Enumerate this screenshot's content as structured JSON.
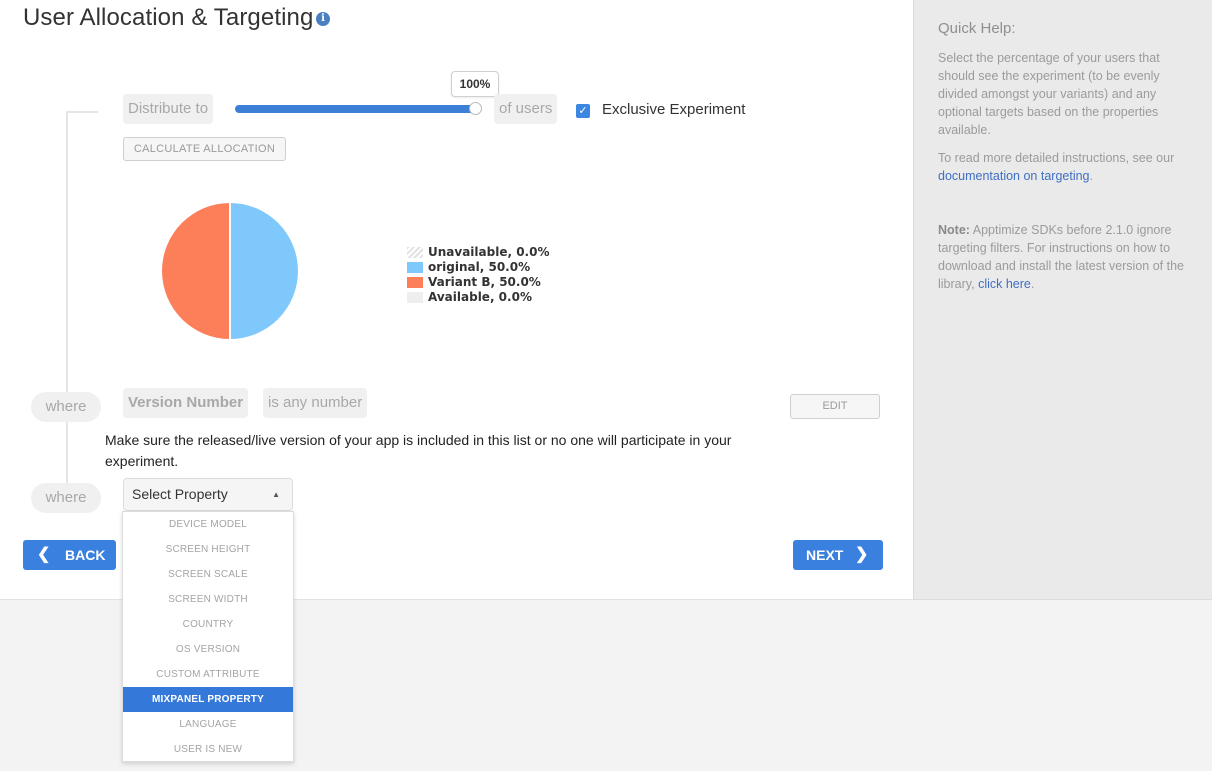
{
  "header": {
    "title": "User Allocation & Targeting"
  },
  "allocation": {
    "distribute_label": "Distribute to",
    "slider_value": "100%",
    "slider_fraction": 1.0,
    "of_users_label": "of users",
    "exclusive_checked": true,
    "exclusive_label": "Exclusive Experiment",
    "calculate_label": "CALCULATE ALLOCATION"
  },
  "pie": {
    "legend": [
      {
        "label": "Unavailable, 0.0%",
        "value": 0.0,
        "color": "hatched"
      },
      {
        "label": "original, 50.0%",
        "value": 50.0,
        "color": "#7ec8fb"
      },
      {
        "label": "Variant B, 50.0%",
        "value": 50.0,
        "color": "#fc7f5a"
      },
      {
        "label": "Available, 0.0%",
        "value": 0.0,
        "color": "#eeeeee"
      }
    ]
  },
  "filter1": {
    "where": "where",
    "property": "Version Number",
    "condition": "is any number",
    "edit_label": "EDIT"
  },
  "warning": "Make sure the released/live version of your app is included in this list or no one will participate in your experiment.",
  "filter2": {
    "where": "where",
    "select_value": "Select Property",
    "options": [
      "DEVICE MODEL",
      "SCREEN HEIGHT",
      "SCREEN SCALE",
      "SCREEN WIDTH",
      "COUNTRY",
      "OS VERSION",
      "CUSTOM ATTRIBUTE",
      "MIXPANEL PROPERTY",
      "LANGUAGE",
      "USER IS NEW"
    ],
    "highlighted_index": 7
  },
  "nav": {
    "back_label": "BACK",
    "next_label": "NEXT"
  },
  "help": {
    "title": "Quick Help:",
    "p1": "Select the percentage of your users that should see the experiment (to be evenly divided amongst your variants) and any optional targets based on the properties available.",
    "p2_text": "To read more detailed instructions, see our",
    "p2_link": "documentation on targeting",
    "note_label": "Note:",
    "note_text": "Apptimize SDKs before 2.1.0 ignore targeting filters. For instructions on how to download and install the latest version of the library,",
    "note_link": "click here"
  },
  "colors": {
    "accent": "#3a80df",
    "original": "#7ec8fb",
    "variant_b": "#fc7f5a"
  }
}
